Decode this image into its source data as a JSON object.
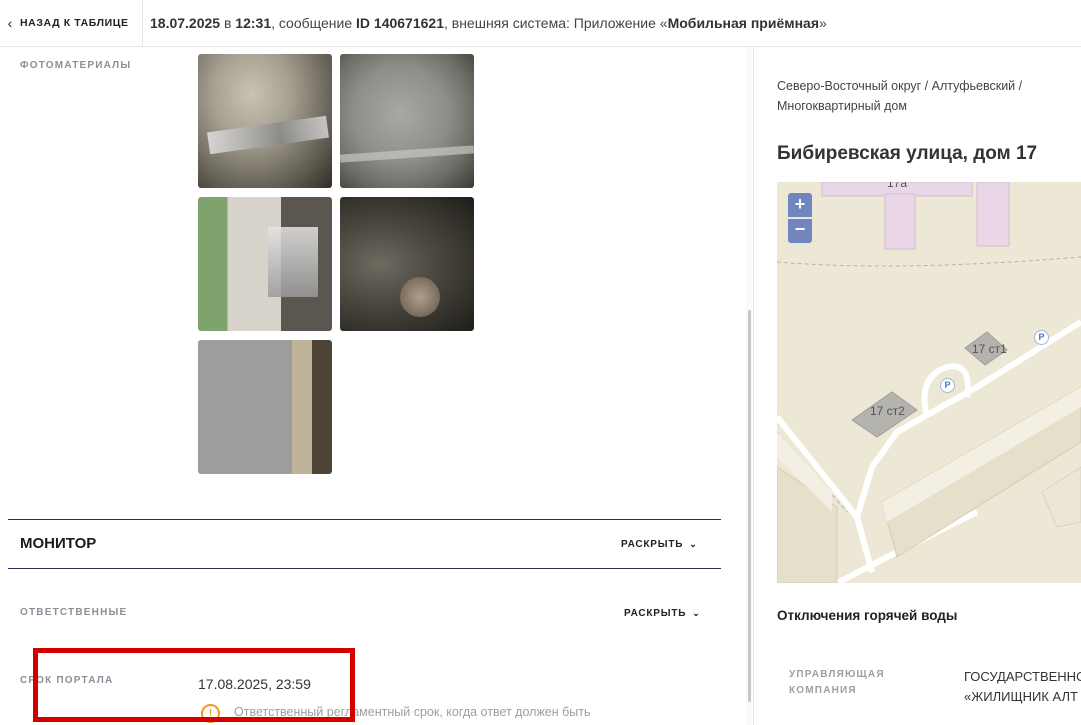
{
  "header": {
    "back_label": "НАЗАД К ТАБЛИЦЕ",
    "date": "18.07.2025",
    "at": " в ",
    "time": "12:31",
    "msg_text": ", сообщение ",
    "id_text": "ID 140671621",
    "external_text": ", внешняя система: Приложение «",
    "app_name": "Мобильная приёмная",
    "close_quote": "»"
  },
  "photos": {
    "label": "ФОТОМАТЕРИАЛЫ",
    "count": 5
  },
  "monitor": {
    "title": "МОНИТОР",
    "expand_label": "РАСКРЫТЬ"
  },
  "responsible": {
    "label": "ОТВЕТСТВЕННЫЕ",
    "expand_label": "РАСКРЫТЬ"
  },
  "portal_deadline": {
    "label": "СРОК ПОРТАЛА",
    "value": "17.08.2025, 23:59",
    "hint": "Ответственный регламентный срок, когда ответ должен быть"
  },
  "location": {
    "breadcrumb_line1": "Северо-Восточный округ / Алтуфьевский /",
    "breadcrumb_line2": "Многоквартирный дом",
    "address": "Бибиревская улица, дом 17"
  },
  "map": {
    "zoom_in": "+",
    "zoom_out": "−",
    "labels": [
      "17а",
      "17 ст1",
      "17 ст2"
    ],
    "parking": "P"
  },
  "hot_water_outage": "Отключения горячей воды",
  "management": {
    "label_line1": "УПРАВЛЯЮЩАЯ",
    "label_line2": "КОМПАНИЯ",
    "value_line1": "ГОСУДАРСТВЕННОЕ",
    "value_line2": "«ЖИЛИЩНИК АЛТ"
  },
  "colors": {
    "highlight": "#d40000",
    "divider": "#2a2f5a",
    "zoom_button": "#7186bf",
    "warning": "#f29b1a"
  }
}
